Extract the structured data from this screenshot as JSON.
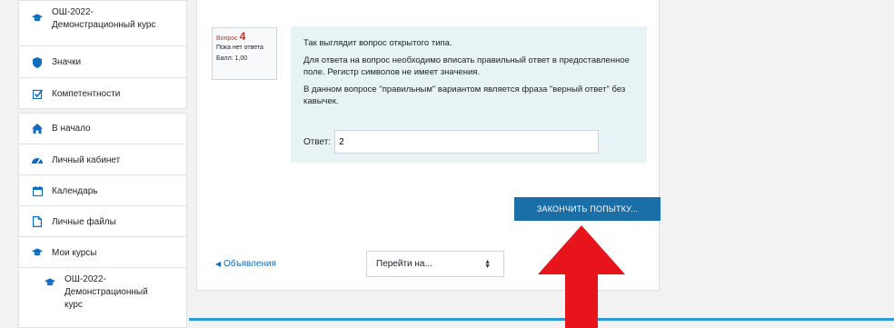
{
  "sidebar": {
    "top_course": "ОШ-2022-Демонстрационный курс",
    "top_course_lines": [
      "ОШ-2022-",
      "Демонстрационный курс"
    ],
    "badges": "Значки",
    "competencies": "Компетентности",
    "home": "В начало",
    "dashboard": "Личный кабинет",
    "calendar": "Календарь",
    "private_files": "Личные файлы",
    "my_courses": "Мои курсы",
    "sub_course_lines": [
      "ОШ-2022-",
      "Демонстрационный",
      "курс"
    ]
  },
  "question": {
    "label": "Вопрос",
    "number": "4",
    "status": "Пока нет ответа",
    "mark": "Балл: 1,00",
    "paragraphs": [
      "Так выглядит вопрос открытого типа.",
      "Для ответа на вопрос необходимо вписать правильный ответ в предоставленное поле. Регистр символов не имеет значения.",
      "В данном вопросе \"правильным\" вариантом является фраза \"верный ответ\" без кавычек."
    ],
    "answer_label": "Ответ:",
    "answer_value": "2"
  },
  "actions": {
    "finish_label": "ЗАКОНЧИТЬ ПОПЫТКУ...",
    "prev_link": "Объявления",
    "jump_label": "Перейти на..."
  },
  "colors": {
    "accent": "#1b6fa8",
    "question_bg": "#e7f3f5",
    "arrow": "#e8141b",
    "line": "#2d9ad6"
  }
}
